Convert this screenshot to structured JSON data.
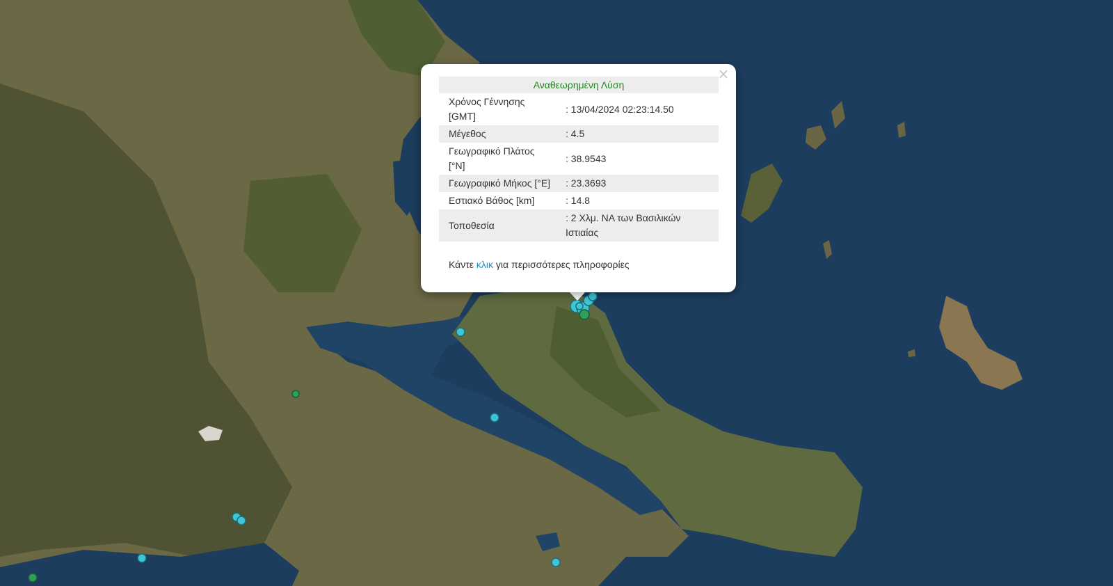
{
  "map": {
    "colors": {
      "sea": "#1a3a5c",
      "land": "#6b6a45",
      "mountain": "#4a5230",
      "event_cyan": "#3fc6d6",
      "event_green": "#2e9e5a"
    }
  },
  "popup": {
    "close_icon": "×",
    "title": "Αναθεωρημένη Λύση",
    "rows": [
      {
        "key": "Χρόνος Γέννησης [GMT]",
        "value": ": 13/04/2024 02:23:14.50"
      },
      {
        "key": "Μέγεθος",
        "value": ": 4.5"
      },
      {
        "key": "Γεωγραφικό Πλάτος [°N]",
        "value": ": 38.9543"
      },
      {
        "key": "Γεωγραφικό Μήκος [°E]",
        "value": ": 23.3693"
      },
      {
        "key": "Εστιακό Βάθος [km]",
        "value": ": 14.8"
      },
      {
        "key": "Τοποθεσία",
        "value": ": 2 Χλμ. ΝΑ των Βασιλικών Ιστιαίας"
      }
    ],
    "more_prefix": "Κάντε ",
    "more_link": "κλικ",
    "more_suffix": " για περισσότερες πληροφορίες"
  }
}
